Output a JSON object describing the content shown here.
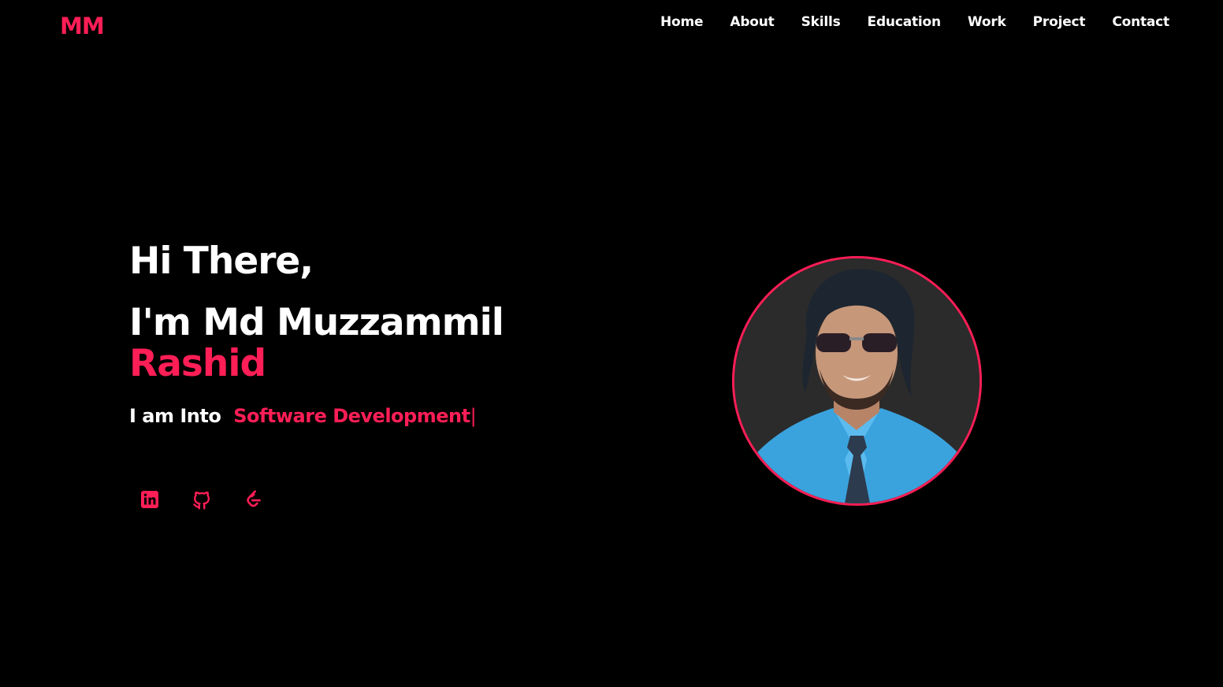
{
  "header": {
    "logo": "MM",
    "nav": [
      "Home",
      "About",
      "Skills",
      "Education",
      "Work",
      "Project",
      "Contact"
    ]
  },
  "hero": {
    "greeting": "Hi There,",
    "intro_prefix": "I'm Md Muzzammil",
    "intro_accent": "Rashid",
    "role_prefix": "I am Into",
    "role": "Software Development",
    "cursor": "|"
  },
  "socials": [
    {
      "name": "linkedin-icon"
    },
    {
      "name": "github-icon"
    },
    {
      "name": "leetcode-icon"
    }
  ],
  "colors": {
    "background": "#000000",
    "accent": "#ff1e56",
    "text": "#ffffff"
  }
}
